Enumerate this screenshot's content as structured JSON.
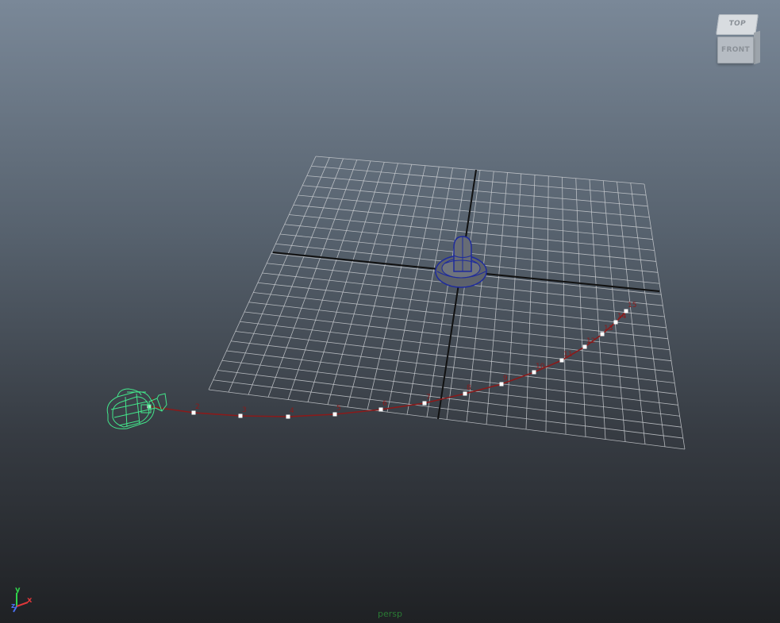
{
  "view": {
    "camera_name": "persp",
    "background_top": "#7a8898",
    "background_bottom": "#1f2124"
  },
  "view_cube": {
    "top_label": "TOP",
    "front_label": "FRONT"
  },
  "axis_indicator": {
    "y_label": "y",
    "x_label": "x",
    "z_label": "z",
    "y_color": "#2fd24a",
    "x_color": "#e0383a",
    "z_color": "#4a6ff0"
  },
  "scene": {
    "grid_color": "#c9ccd0",
    "grid_axis_color": "#111111",
    "motion_path_color": "#8b1a1a",
    "camera_wire_color": "#43e68b",
    "object_color": "#5d626b",
    "object_wire_color": "#1e2b9c",
    "objects": [
      {
        "name": "camera-rig",
        "selected": true
      },
      {
        "name": "mushroom-mesh",
        "selected": false
      }
    ],
    "motion_path_frames": [
      "1",
      "2",
      "3",
      "4",
      "5",
      "6",
      "7",
      "8",
      "9",
      "10",
      "11",
      "12",
      "13",
      "14",
      "15"
    ]
  }
}
